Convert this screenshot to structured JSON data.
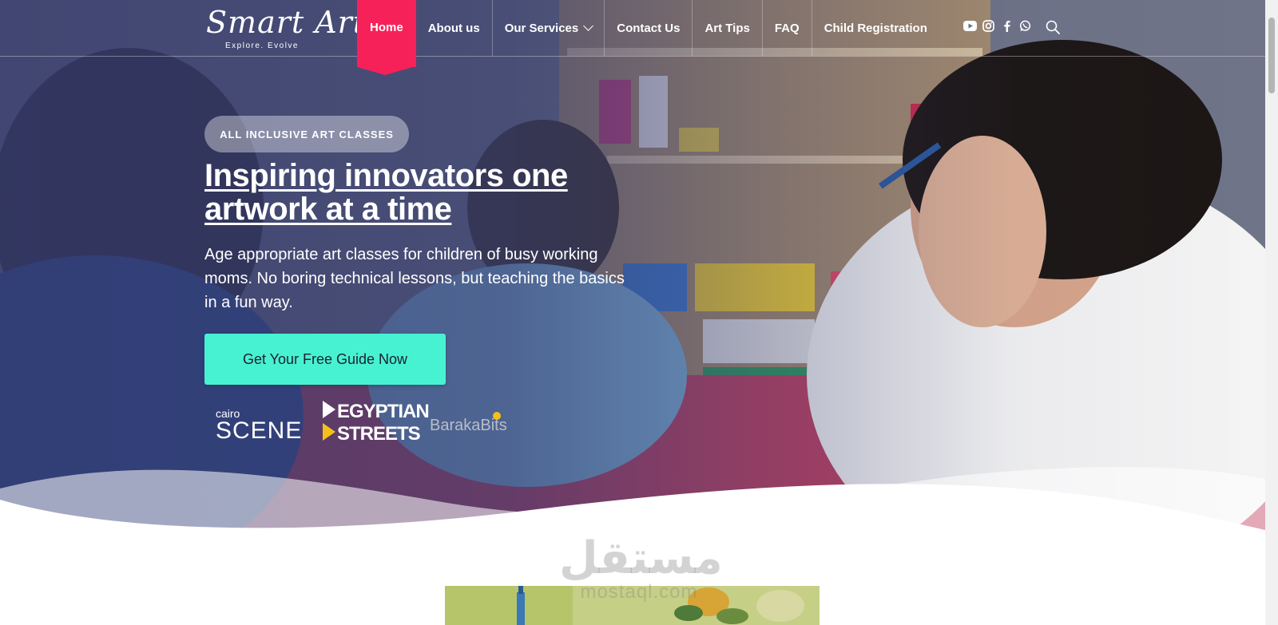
{
  "logo": {
    "script_text": "Smart Art",
    "tagline": "Explore. Evolve"
  },
  "nav": {
    "home": "Home",
    "about": "About us",
    "services": "Our Services",
    "contact": "Contact Us",
    "art_tips": "Art Tips",
    "faq": "FAQ",
    "child_registration": "Child Registration"
  },
  "social": [
    "youtube-icon",
    "instagram-icon",
    "facebook-icon",
    "whatsapp-icon"
  ],
  "hero": {
    "badge": "ALL INCLUSIVE ART CLASSES",
    "headline": "Inspiring innovators one artwork at a time",
    "subtext": "Age appropriate art classes for children of busy working moms. No boring technical lessons, but teaching the basics in a fun way.",
    "cta": "Get Your Free Guide Now"
  },
  "press": {
    "cairo_small": "cairo",
    "cairo_big": "SCENE",
    "egypt_line1": "EGYPTIAN",
    "egypt_line2": "STREETS",
    "baraka": "BarakaBits"
  },
  "watermark": {
    "arabic": "مستقل",
    "latin": "mostaql.com"
  },
  "colors": {
    "accent": "#f7215a",
    "cta": "#47f2d2",
    "overlay": "#343a6c"
  }
}
